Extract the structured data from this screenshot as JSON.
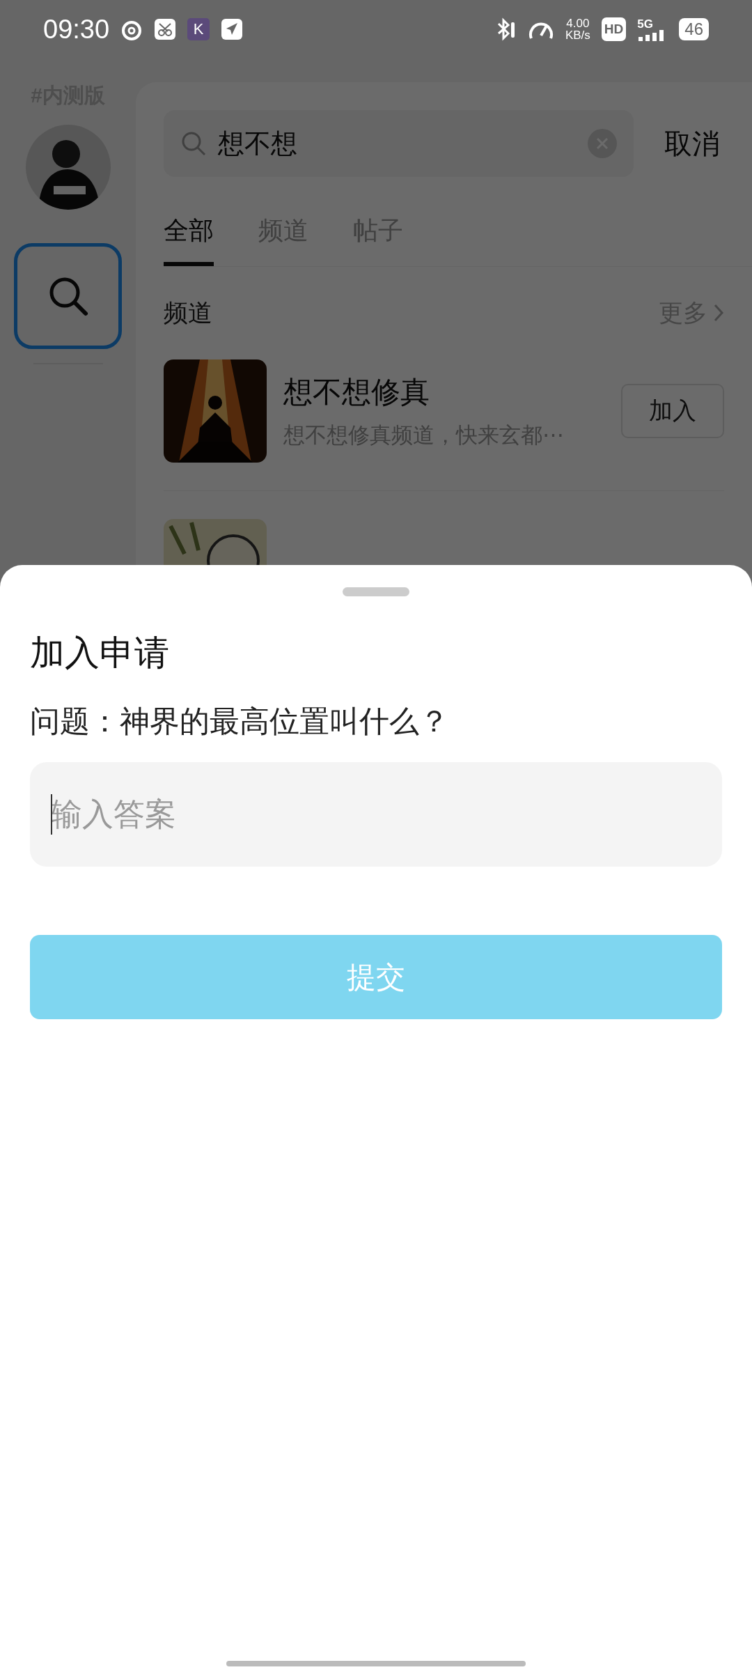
{
  "status_bar": {
    "time": "09:30",
    "app_badge": "K",
    "net_speed": "4.00",
    "net_speed_unit": "KB/s",
    "hd_badge": "HD",
    "network": "5G",
    "battery": "46"
  },
  "sidebar": {
    "label": "#内测版",
    "items": [
      {
        "kind": "avatar",
        "selected": false
      },
      {
        "kind": "search",
        "selected": true
      }
    ]
  },
  "search": {
    "value": "想不想",
    "cancel": "取消"
  },
  "tabs": [
    {
      "label": "全部",
      "selected": true
    },
    {
      "label": "频道",
      "selected": false
    },
    {
      "label": "帖子",
      "selected": false
    }
  ],
  "section": {
    "title": "频道",
    "more": "更多"
  },
  "channels": [
    {
      "name": "想不想修真",
      "description": "想不想修真频道，快来玄都⋯",
      "action": "加入"
    }
  ],
  "sheet": {
    "title": "加入申请",
    "question": "问题：神界的最高位置叫什么？",
    "answer": {
      "placeholder": "输入答案",
      "focused": true
    },
    "submit": {
      "label": "提交",
      "disabled": true
    }
  }
}
